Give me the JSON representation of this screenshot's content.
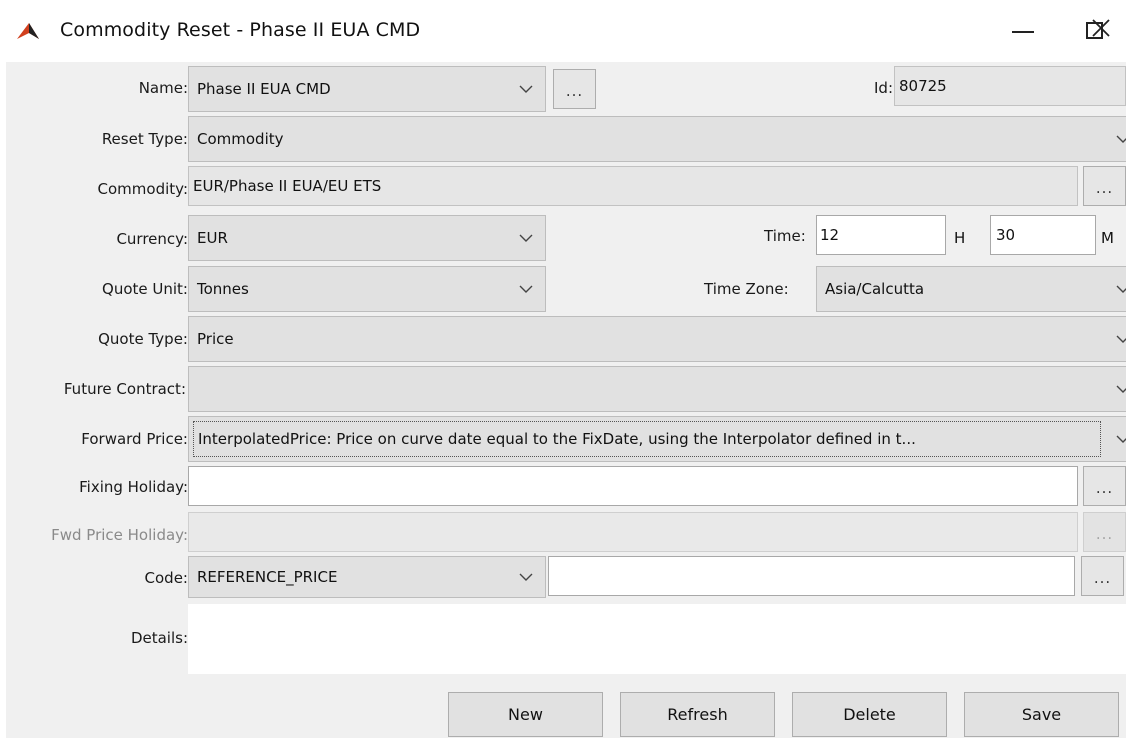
{
  "window": {
    "title": "Commodity Reset - Phase II EUA CMD",
    "icon": "app-logo-icon",
    "controls": {
      "minimize": "minimize-icon",
      "maximize": "maximize-icon",
      "close": "close-icon"
    }
  },
  "form": {
    "name": {
      "label": "Name:",
      "value": "Phase II EUA CMD",
      "browse": "..."
    },
    "id": {
      "label": "Id:",
      "value": "80725"
    },
    "reset_type": {
      "label": "Reset Type:",
      "value": "Commodity"
    },
    "commodity": {
      "label": "Commodity:",
      "value": "EUR/Phase II EUA/EU ETS",
      "browse": "..."
    },
    "currency": {
      "label": "Currency:",
      "value": "EUR"
    },
    "time": {
      "label": "Time:",
      "hours": "12",
      "hours_unit": "H",
      "minutes": "30",
      "minutes_unit": "M"
    },
    "quote_unit": {
      "label": "Quote Unit:",
      "value": "Tonnes"
    },
    "time_zone": {
      "label": "Time Zone:",
      "value": "Asia/Calcutta"
    },
    "quote_type": {
      "label": "Quote Type:",
      "value": "Price"
    },
    "future_contract": {
      "label": "Future Contract:",
      "value": ""
    },
    "forward_price": {
      "label": "Forward Price:",
      "value": "InterpolatedPrice: Price on curve date equal to the FixDate, using the Interpolator defined in t..."
    },
    "fixing_holiday": {
      "label": "Fixing Holiday:",
      "value": "",
      "browse": "..."
    },
    "fwd_price_holiday": {
      "label": "Fwd Price Holiday:",
      "value": "",
      "browse": "..."
    },
    "code": {
      "label": "Code:",
      "value": "REFERENCE_PRICE",
      "text": "",
      "browse": "..."
    },
    "details": {
      "label": "Details:",
      "value": ""
    }
  },
  "buttons": {
    "new": "New",
    "refresh": "Refresh",
    "delete": "Delete",
    "save": "Save"
  },
  "colors": {
    "logo": "#d1401f",
    "panel": "#f0f0f0",
    "combo": "#e1e1e1",
    "field": "#ffffff"
  }
}
